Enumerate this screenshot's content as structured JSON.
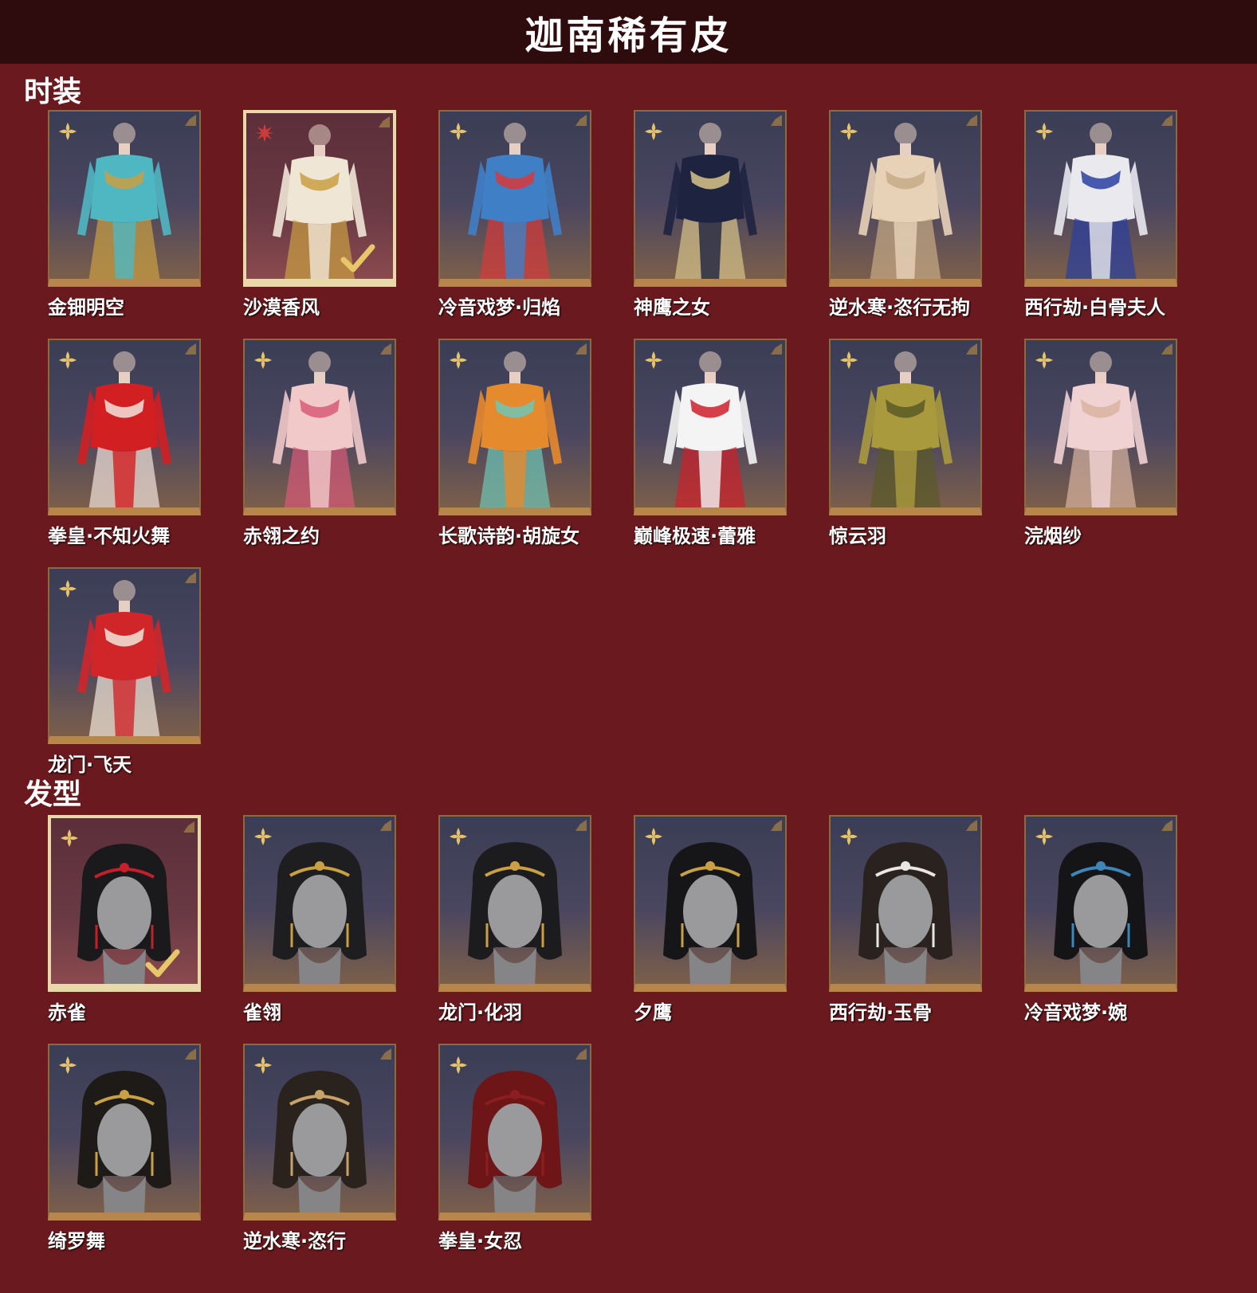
{
  "header": {
    "title": "迦南稀有皮"
  },
  "sections": {
    "outfits": {
      "title": "时装",
      "items": [
        {
          "name": "金钿明空",
          "selected": false,
          "palette": [
            "#4fb7c2",
            "#c9a043"
          ]
        },
        {
          "name": "沙漠香风",
          "selected": true,
          "palette": [
            "#f0e6d6",
            "#c9a043"
          ]
        },
        {
          "name": "冷音戏梦·归焰",
          "selected": false,
          "palette": [
            "#3f7fc6",
            "#d63a3a"
          ]
        },
        {
          "name": "神鹰之女",
          "selected": false,
          "palette": [
            "#1e2340",
            "#d9c48a"
          ]
        },
        {
          "name": "逆水寒·恣行无拘",
          "selected": false,
          "palette": [
            "#e7d2b8",
            "#c7ab86"
          ]
        },
        {
          "name": "西行劫·白骨夫人",
          "selected": false,
          "palette": [
            "#e9e9ee",
            "#2a3fa0"
          ]
        },
        {
          "name": "拳皇·不知火舞",
          "selected": false,
          "palette": [
            "#d21f22",
            "#f2e4dc"
          ]
        },
        {
          "name": "赤翎之约",
          "selected": false,
          "palette": [
            "#f1c9c9",
            "#d85a78"
          ]
        },
        {
          "name": "长歌诗韵·胡旋女",
          "selected": false,
          "palette": [
            "#e68a2e",
            "#6ec6b6"
          ]
        },
        {
          "name": "巅峰极速·蕾雅",
          "selected": false,
          "palette": [
            "#f4f4f4",
            "#cf1f2a"
          ]
        },
        {
          "name": "惊云羽",
          "selected": false,
          "palette": [
            "#a99a3d",
            "#5a5a26"
          ]
        },
        {
          "name": "浣烟纱",
          "selected": false,
          "palette": [
            "#f0d2d2",
            "#d9b3a0"
          ]
        },
        {
          "name": "龙门·飞天",
          "selected": false,
          "palette": [
            "#d0262a",
            "#f2e8da"
          ]
        }
      ]
    },
    "hairstyles": {
      "title": "发型",
      "items": [
        {
          "name": "赤雀",
          "selected": true,
          "palette": [
            "#1a1a1c",
            "#c4202b"
          ]
        },
        {
          "name": "雀翎",
          "selected": false,
          "palette": [
            "#1e1d1f",
            "#c9a043"
          ]
        },
        {
          "name": "龙门·化羽",
          "selected": false,
          "palette": [
            "#1c1b1d",
            "#c9a043"
          ]
        },
        {
          "name": "夕鹰",
          "selected": false,
          "palette": [
            "#161618",
            "#c9a043"
          ]
        },
        {
          "name": "西行劫·玉骨",
          "selected": false,
          "palette": [
            "#29221f",
            "#e8e6e2"
          ]
        },
        {
          "name": "冷音戏梦·婉",
          "selected": false,
          "palette": [
            "#151517",
            "#3f86b8"
          ]
        },
        {
          "name": "绮罗舞",
          "selected": false,
          "palette": [
            "#1e1a18",
            "#c9a043"
          ]
        },
        {
          "name": "逆水寒·恣行",
          "selected": false,
          "palette": [
            "#2a221d",
            "#c7a36a"
          ]
        },
        {
          "name": "拳皇·女忍",
          "selected": false,
          "palette": [
            "#6e1617",
            "#8a1e20"
          ]
        }
      ]
    }
  },
  "colors": {
    "background": "#6a1a1e",
    "title_bar": "#2e0c0e",
    "frame_gold": "#b8864a",
    "rarity_gold": "#e6c36a",
    "rarity_red": "#d23a3a",
    "check_gold": "#e8c66a"
  },
  "icons": {
    "rarity": "four-petal-star-icon",
    "selected": "checkmark-icon",
    "corner": "leaf-corner-icon"
  }
}
